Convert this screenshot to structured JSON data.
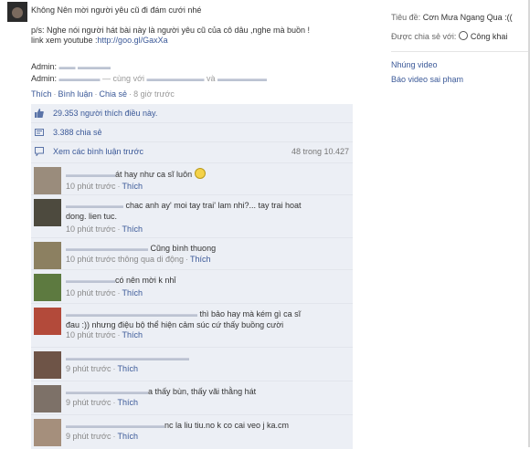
{
  "post": {
    "title": "Không Nên mời người yêu cũ đi đám cưới nhé",
    "body_line1": "p/s: Nghe nói người hát bài này là người yêu cũ của cô dâu ,nghe mà buồn !",
    "link_prefix": "link xem youtube :",
    "link_url": "http://goo.gl/GaxXa",
    "admin1_label": "Admin:",
    "admin2_label": "Admin:",
    "admin2_with": "— cùng với",
    "admin2_and": "và",
    "action_like": "Thích",
    "action_comment": "Bình luận",
    "action_share": "Chia sẻ",
    "timestamp": "8 giờ trước"
  },
  "ufi": {
    "likes_text": "29.353 người thích điều này.",
    "shares_text": "3.388 chia sẻ",
    "view_prev": "Xem các bình luận trước",
    "pager": "48 trong 10.427"
  },
  "comments": [
    {
      "text": "át hay như ca sĩ luôn",
      "time": "10 phút trước",
      "like": "Thích"
    },
    {
      "text": "chac anh ay' moi tay trai' lam nhi?... tay trai hoat",
      "text2": "dong. lien tuc.",
      "time": "10 phút trước",
      "like": "Thích"
    },
    {
      "text": "Cũng bình thuong",
      "time": "10 phút trước thông qua di động",
      "like": "Thích"
    },
    {
      "text": "có nên mời k nhỉ",
      "time": "10 phút trước",
      "like": "Thích"
    },
    {
      "text": "thì bảo hay mà kém gì ca sĩ",
      "text2": "đau :)) nhưng điệu bộ thể hiện cảm súc cứ thấy buồng cười",
      "time": "10 phút trước",
      "like": "Thích"
    },
    {
      "text": "",
      "time": "9 phút trước",
      "like": "Thích"
    },
    {
      "text": "a thấy bùn, thấy vãi thằng hát",
      "time": "9 phút trước",
      "like": "Thích"
    },
    {
      "text": "nc la liu tiu.no k co cai veo j ka.cm",
      "time": "9 phút trước",
      "like": "Thích"
    }
  ],
  "sidebar": {
    "title_label": "Tiêu đề:",
    "title_value": "Cơn Mưa Ngang Qua :((",
    "shared_label": "Được chia sẻ với:",
    "shared_value": "Công khai",
    "link_video": "Nhúng video",
    "link_report": "Báo video sai phạm"
  },
  "colors": {
    "link": "#3b5998",
    "ufi_bg": "#eceff5"
  }
}
